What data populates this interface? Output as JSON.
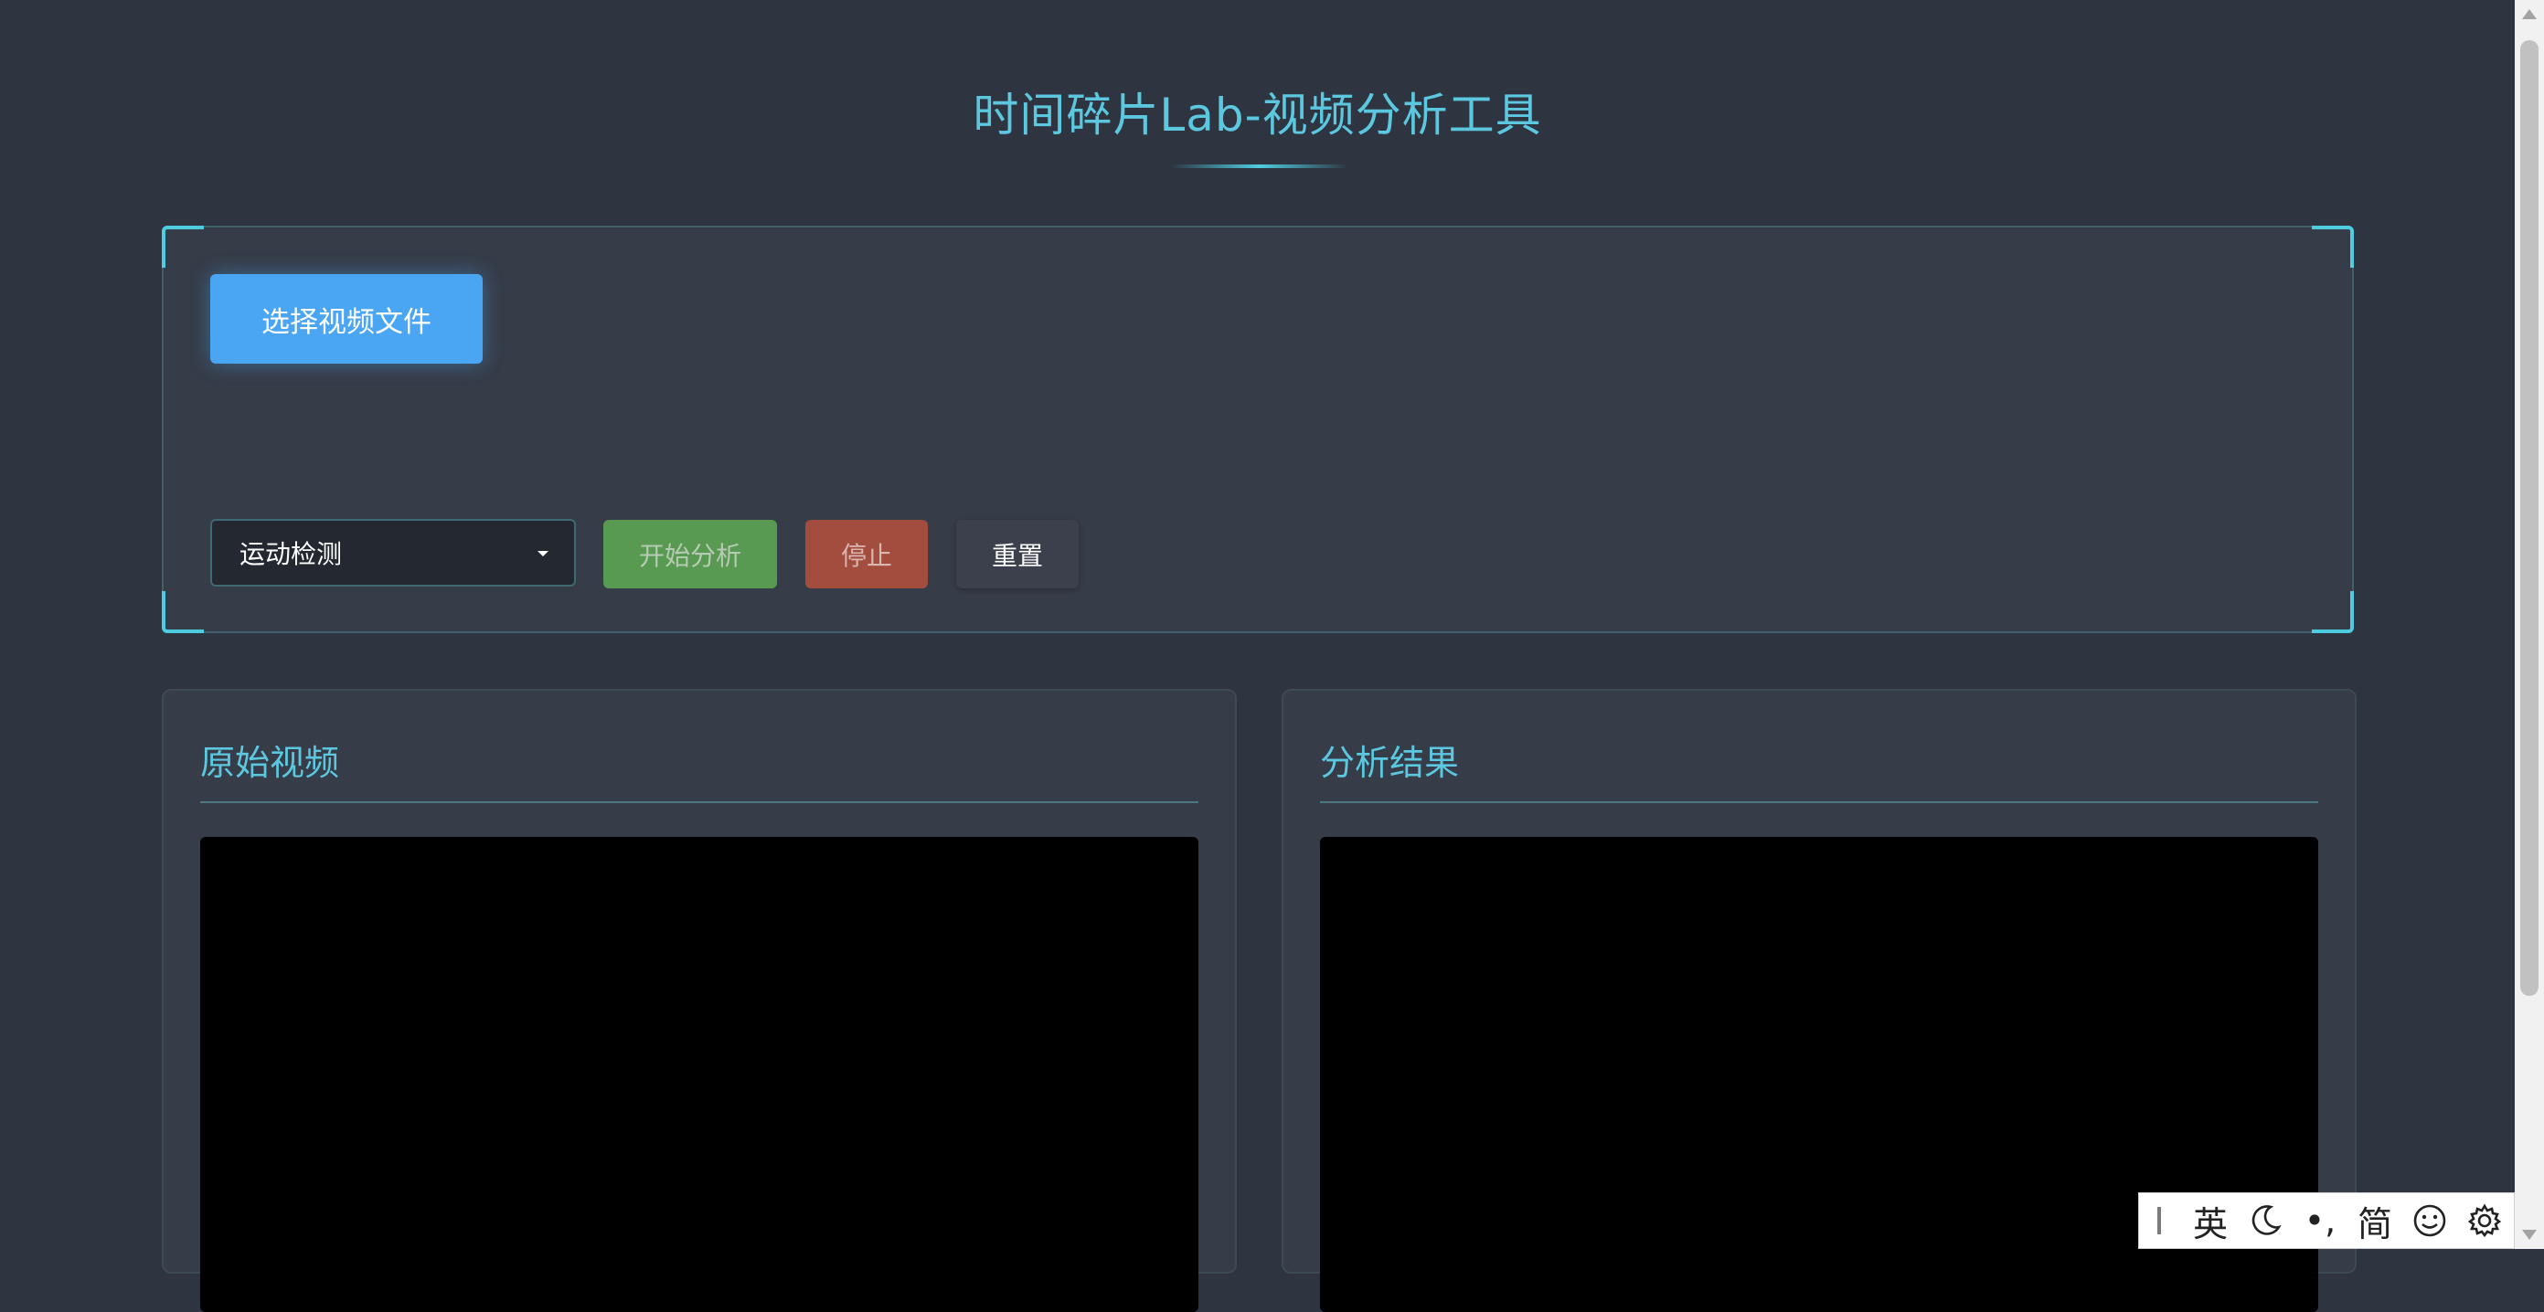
{
  "header": {
    "title": "时间碎片Lab-视频分析工具"
  },
  "controls": {
    "select_file_label": "选择视频文件",
    "mode_select": {
      "selected": "运动检测"
    },
    "start_label": "开始分析",
    "stop_label": "停止",
    "reset_label": "重置"
  },
  "panels": {
    "original": {
      "title": "原始视频"
    },
    "result": {
      "title": "分析结果"
    }
  },
  "ime_toolbar": {
    "lang_label": "英",
    "punct_label": "•,",
    "script_label": "简",
    "icons": [
      "moon-icon",
      "smiley-icon",
      "gear-icon"
    ]
  },
  "colors": {
    "accent": "#4ecde0",
    "primary_button": "#4aa6f2",
    "start_button": "#599a52",
    "stop_button": "#a24d3e",
    "background": "#2e3440",
    "panel": "#363c48"
  }
}
